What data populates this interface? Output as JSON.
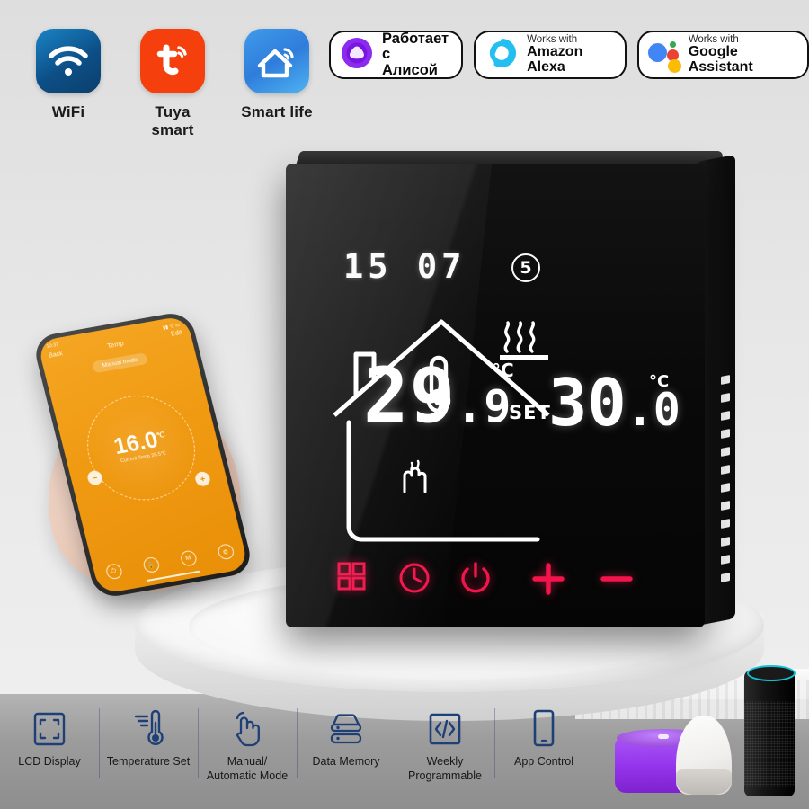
{
  "apps": [
    {
      "label": "WiFi",
      "icon": "wifi-icon"
    },
    {
      "label": "Tuya smart",
      "icon": "tuya-icon"
    },
    {
      "label": "Smart life",
      "icon": "smart-life-house-icon"
    }
  ],
  "badges": [
    {
      "id": "alice",
      "icon": "yandex-alice-icon",
      "line1": "Работает",
      "line2": "с Алисой"
    },
    {
      "id": "alexa",
      "icon": "amazon-alexa-icon",
      "line1": "Works with",
      "line2": "Amazon Alexa"
    },
    {
      "id": "google",
      "icon": "google-assistant-icon",
      "line1": "Works with",
      "line2": "Google Assistant"
    }
  ],
  "thermostat": {
    "time": "15 07",
    "day_of_week": "5",
    "current_temp": "29",
    "current_temp_decimal": ".9",
    "current_unit": "°C",
    "set_label": "SET",
    "set_temp": "30",
    "set_temp_decimal": ".0",
    "set_unit": "°C",
    "icons": {
      "house": "house-outline-icon",
      "thermometer": "thermometer-icon",
      "floor_heating": "floor-heating-waves-icon",
      "hand_heat": "hand-heat-icon",
      "day_badge": "circled-day-number"
    },
    "buttons": [
      {
        "name": "menu-grid-button",
        "icon": "grid-icon"
      },
      {
        "name": "clock-timer-button",
        "icon": "clock-icon"
      },
      {
        "name": "power-button",
        "icon": "power-icon"
      },
      {
        "name": "increase-temp-button",
        "icon": "plus-icon"
      },
      {
        "name": "decrease-temp-button",
        "icon": "minus-icon"
      }
    ],
    "button_color": "#f3144b"
  },
  "phone_app": {
    "status_time": "10:37",
    "back_label": "Back",
    "title": "Temp",
    "edit_label": "Edit",
    "mode_pill": "Manual mode",
    "value": "16.0",
    "unit": "℃",
    "subtitle": "Current Temp 26.5℃",
    "minus": "−",
    "plus": "+",
    "tabs": [
      {
        "name": "power-tab",
        "glyph": "⏻"
      },
      {
        "name": "lock-tab",
        "glyph": "🔒"
      },
      {
        "name": "mode-tab",
        "glyph": "M"
      },
      {
        "name": "settings-tab",
        "glyph": "⚙"
      }
    ]
  },
  "features": [
    {
      "label": "LCD Display",
      "icon": "lcd-frame-icon"
    },
    {
      "label": "Temperature Set",
      "icon": "thermometer-set-icon"
    },
    {
      "label": "Manual/\nAutomatic Mode",
      "icon": "touch-hand-icon"
    },
    {
      "label": "Data Memory",
      "icon": "data-stack-icon"
    },
    {
      "label": "Weekly\nProgrammable",
      "icon": "code-brackets-icon"
    },
    {
      "label": "App Control",
      "icon": "smartphone-icon"
    }
  ],
  "speakers": [
    {
      "name": "yandex-station-speaker",
      "color": "#9333ea"
    },
    {
      "name": "google-home-speaker",
      "color": "#f0efed"
    },
    {
      "name": "amazon-echo-speaker",
      "color": "#141414"
    }
  ],
  "colors": {
    "background": "#d9d9d9",
    "accent_red": "#f3144b",
    "tuya_orange": "#f5400d",
    "alexa_cyan": "#22bff0",
    "alice_purple": "#8b2bed",
    "feature_navy": "#1f3f77"
  }
}
